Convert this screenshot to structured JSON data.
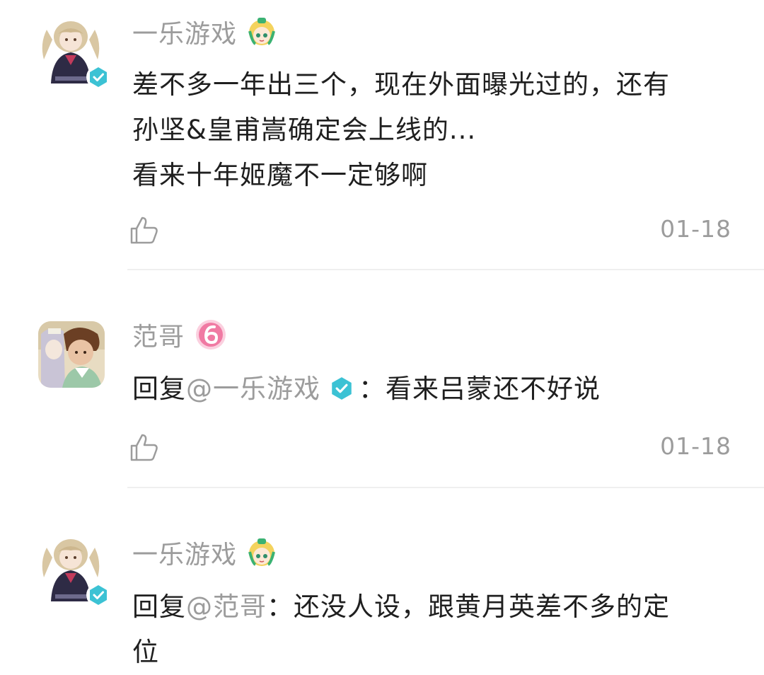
{
  "comments": [
    {
      "username": "一乐游戏",
      "badge_icon": "cartoon-girl-level-icon",
      "lines": [
        "差不多一年出三个，现在外面曝光过的，还有",
        "孙坚&皇甫嵩确定会上线的...",
        "看来十年姬魔不一定够啊"
      ],
      "date": "01-18",
      "verified": true
    },
    {
      "username": "范哥",
      "badge_icon": "pink-level-6-icon",
      "reply_prefix": "回复",
      "mention": "@一乐游戏",
      "reply_text": "：看来吕蒙还不好说",
      "date": "01-18",
      "verified": false
    },
    {
      "username": "一乐游戏",
      "badge_icon": "cartoon-girl-level-icon",
      "reply_prefix": "回复",
      "mention": "@范哥",
      "reply_lines": [
        "：还没人设，跟黄月英差不多的定",
        "位"
      ],
      "verified": true
    }
  ],
  "colors": {
    "verified": "#3cc2d4",
    "muted_text": "#9c9c9c",
    "body_text": "#1f1f1f",
    "level_badge_pink": "#f07aa3"
  }
}
